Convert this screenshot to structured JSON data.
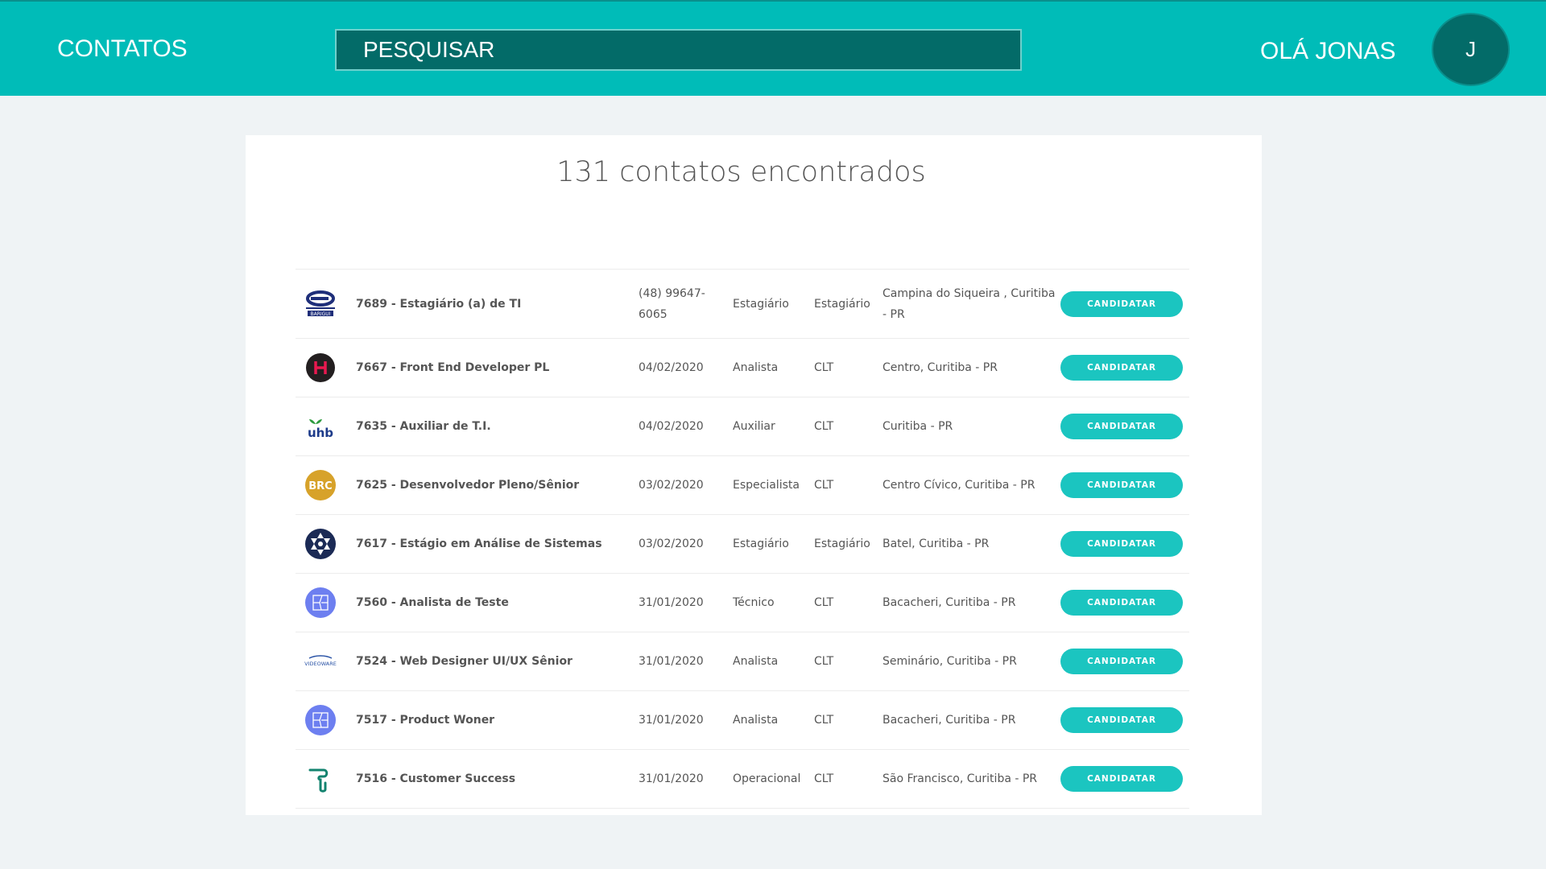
{
  "header": {
    "brand": "CONTATOS",
    "search_placeholder": "PESQUISAR",
    "greeting": "OLÁ JONAS",
    "avatar_initial": "J"
  },
  "results": {
    "title": "131 contatos encontrados",
    "button_label": "CANDIDATAR",
    "rows": [
      {
        "logo": "barigui-logo",
        "title": "7689 - Estagiário (a) de TI",
        "date": "(48) 99647-6065",
        "level": "Estagiário",
        "type": "Estagiário",
        "location": "Campina do Siqueira , Curitiba - PR"
      },
      {
        "logo": "h-logo",
        "title": "7667 - Front End Developer PL",
        "date": "04/02/2020",
        "level": "Analista",
        "type": "CLT",
        "location": "Centro, Curitiba - PR"
      },
      {
        "logo": "uhb-logo",
        "title": "7635 - Auxiliar de T.I.",
        "date": "04/02/2020",
        "level": "Auxiliar",
        "type": "CLT",
        "location": "Curitiba - PR"
      },
      {
        "logo": "brc-logo",
        "title": "7625 - Desenvolvedor Pleno/Sênior",
        "date": "03/02/2020",
        "level": "Especialista",
        "type": "CLT",
        "location": "Centro Cívico, Curitiba - PR"
      },
      {
        "logo": "snowflake-logo",
        "title": "7617 - Estágio em Análise de Sistemas",
        "date": "03/02/2020",
        "level": "Estagiário",
        "type": "Estagiário",
        "location": "Batel, Curitiba - PR"
      },
      {
        "logo": "map-logo",
        "title": "7560 - Analista de Teste",
        "date": "31/01/2020",
        "level": "Técnico",
        "type": "CLT",
        "location": "Bacacheri, Curitiba - PR"
      },
      {
        "logo": "videoware-logo",
        "title": "7524 - Web Designer UI/UX Sênior",
        "date": "31/01/2020",
        "level": "Analista",
        "type": "CLT",
        "location": "Seminário, Curitiba - PR"
      },
      {
        "logo": "map-logo",
        "title": "7517 - Product Woner",
        "date": "31/01/2020",
        "level": "Analista",
        "type": "CLT",
        "location": "Bacacheri, Curitiba - PR"
      },
      {
        "logo": "hook-logo",
        "title": "7516 - Customer Success",
        "date": "31/01/2020",
        "level": "Operacional",
        "type": "CLT",
        "location": "São Francisco, Curitiba - PR"
      }
    ]
  },
  "colors": {
    "header": "#00bcb8",
    "search_bg": "#036b68",
    "button": "#1bc5c0",
    "page_bg": "#eff3f5"
  }
}
